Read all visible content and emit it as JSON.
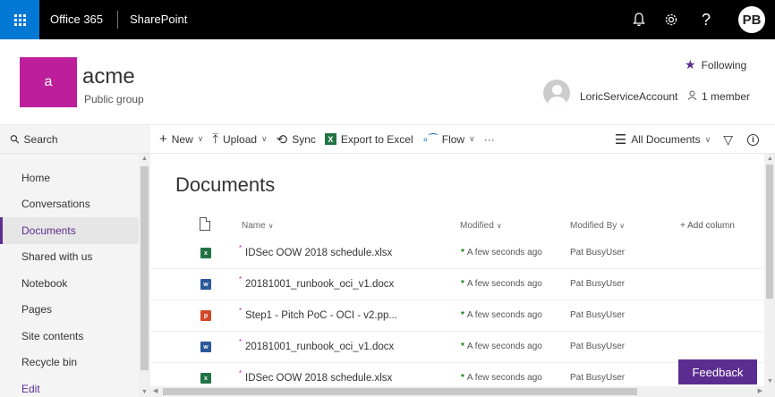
{
  "suite": {
    "brand": "Office 365",
    "app": "SharePoint",
    "user_initials": "PB",
    "icons": [
      "waffle-icon",
      "bell-icon",
      "gear-icon",
      "help-icon"
    ],
    "help_glyph": "?"
  },
  "site": {
    "logo_letter": "a",
    "title": "acme",
    "subtitle": "Public group",
    "following_label": "Following",
    "account_name": "LoricServiceAccount",
    "members_label": "1 member",
    "logo_color": "#bd1e9c"
  },
  "nav": {
    "search_label": "Search",
    "items": [
      {
        "label": "Home"
      },
      {
        "label": "Conversations"
      },
      {
        "label": "Documents"
      },
      {
        "label": "Shared with us"
      },
      {
        "label": "Notebook"
      },
      {
        "label": "Pages"
      },
      {
        "label": "Site contents"
      },
      {
        "label": "Recycle bin"
      },
      {
        "label": "Edit"
      }
    ],
    "active_index": 2
  },
  "commands": {
    "new": "New",
    "upload": "Upload",
    "sync": "Sync",
    "export": "Export to Excel",
    "flow": "Flow",
    "more": "···",
    "view": "All Documents"
  },
  "library": {
    "title": "Documents",
    "columns": {
      "name": "Name",
      "modified": "Modified",
      "modified_by": "Modified By",
      "add_column": "+ Add column"
    },
    "rows": [
      {
        "type": "xlsx",
        "icon_letter": "x",
        "name": "IDSec OOW 2018 schedule.xlsx",
        "modified": "A few seconds ago",
        "modified_by": "Pat BusyUser"
      },
      {
        "type": "docx",
        "icon_letter": "w",
        "name": "20181001_runbook_oci_v1.docx",
        "modified": "A few seconds ago",
        "modified_by": "Pat BusyUser"
      },
      {
        "type": "pptx",
        "icon_letter": "p",
        "name": "Step1 - Pitch PoC - OCI - v2.pp...",
        "modified": "A few seconds ago",
        "modified_by": "Pat BusyUser"
      },
      {
        "type": "docx",
        "icon_letter": "w",
        "name": "20181001_runbook_oci_v1.docx",
        "modified": "A few seconds ago",
        "modified_by": "Pat BusyUser"
      },
      {
        "type": "xlsx",
        "icon_letter": "x",
        "name": "IDSec OOW 2018 schedule.xlsx",
        "modified": "A few seconds ago",
        "modified_by": "Pat BusyUser"
      }
    ]
  },
  "feedback_label": "Feedback",
  "colors": {
    "suite_bar": "#000000",
    "waffle": "#0078d4",
    "accent": "#5c2d91",
    "new_asterisk": "#107c10"
  }
}
